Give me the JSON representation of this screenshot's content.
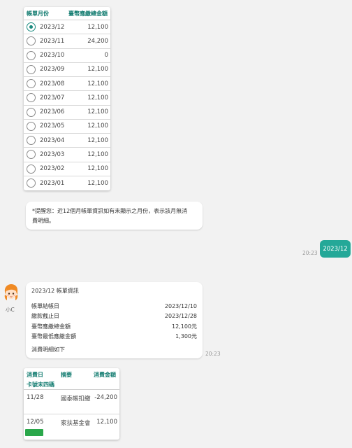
{
  "bill_table": {
    "header": {
      "month_col": "帳單月份",
      "amount_col": "臺幣應繳總金額"
    },
    "rows": [
      {
        "month": "2023/12",
        "amount": "12,100",
        "selected": true
      },
      {
        "month": "2023/11",
        "amount": "24,200",
        "selected": false
      },
      {
        "month": "2023/10",
        "amount": "0",
        "selected": false
      },
      {
        "month": "2023/09",
        "amount": "12,100",
        "selected": false
      },
      {
        "month": "2023/08",
        "amount": "12,100",
        "selected": false
      },
      {
        "month": "2023/07",
        "amount": "12,100",
        "selected": false
      },
      {
        "month": "2023/06",
        "amount": "12,100",
        "selected": false
      },
      {
        "month": "2023/05",
        "amount": "12,100",
        "selected": false
      },
      {
        "month": "2023/04",
        "amount": "12,100",
        "selected": false
      },
      {
        "month": "2023/03",
        "amount": "12,100",
        "selected": false
      },
      {
        "month": "2023/02",
        "amount": "12,100",
        "selected": false
      },
      {
        "month": "2023/01",
        "amount": "12,100",
        "selected": false
      }
    ]
  },
  "notice": {
    "line1": "*提醒您：近12個月帳單資訊如有未顯示之月份，表示該月無消",
    "line2": "費明細。"
  },
  "user_message": {
    "text": "2023/12",
    "time": "20:23"
  },
  "bot": {
    "name": "小C",
    "card": {
      "title": "2023/12 帳單資訊",
      "rows": [
        {
          "label": "帳單結帳日",
          "value": "2023/12/10"
        },
        {
          "label": "繳款截止日",
          "value": "2023/12/28"
        },
        {
          "label": "臺幣應繳總金額",
          "value": "12,100元"
        },
        {
          "label": "臺幣最低應繳金額",
          "value": "1,300元"
        }
      ],
      "footer": "消費明細如下"
    },
    "time": "20:23"
  },
  "transactions": {
    "header": {
      "date": "消費日",
      "desc": "摘要",
      "amount": "消費金額",
      "card": "卡號末四碼"
    },
    "rows": [
      {
        "date": "11/28",
        "desc": "國泰帳扣繳",
        "amount": "-24,200"
      },
      {
        "date": "12/05",
        "desc": "家扶基金會",
        "amount": "12,100"
      }
    ]
  },
  "colors": {
    "accent": "#24a898",
    "header_text": "#0f7a6e",
    "tag_green": "#2aa74a"
  }
}
